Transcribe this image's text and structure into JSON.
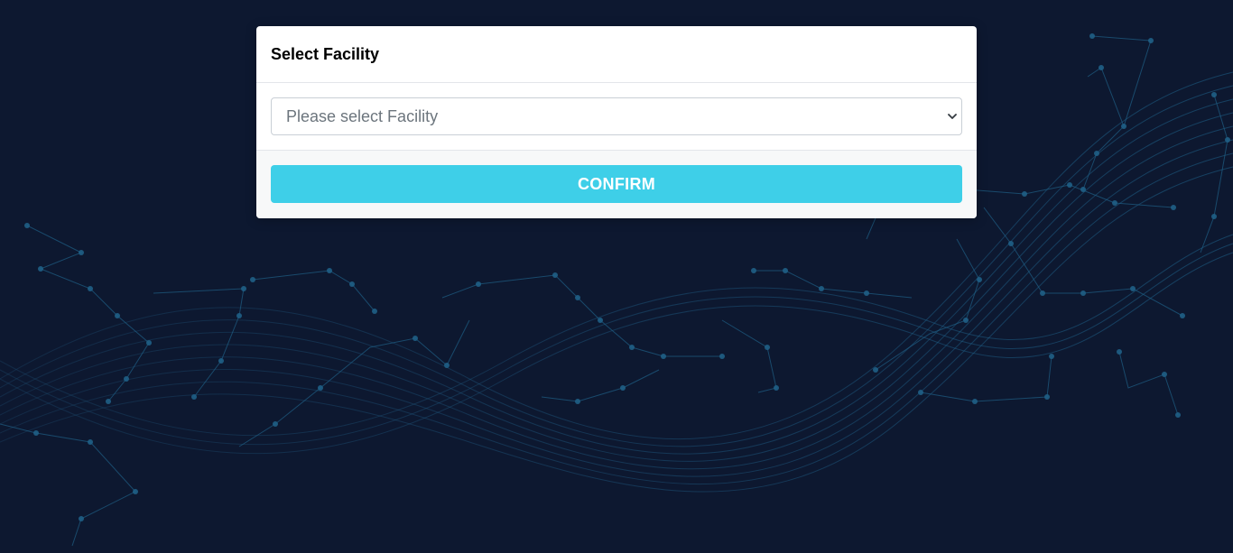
{
  "card": {
    "title": "Select Facility"
  },
  "facility_select": {
    "placeholder": "Please select Facility",
    "icon": "chevron-down-icon"
  },
  "footer": {
    "confirm_label": "CONFIRM"
  },
  "colors": {
    "background": "#0d1830",
    "accent": "#3ecfe8",
    "network_line": "#1f5f86"
  }
}
